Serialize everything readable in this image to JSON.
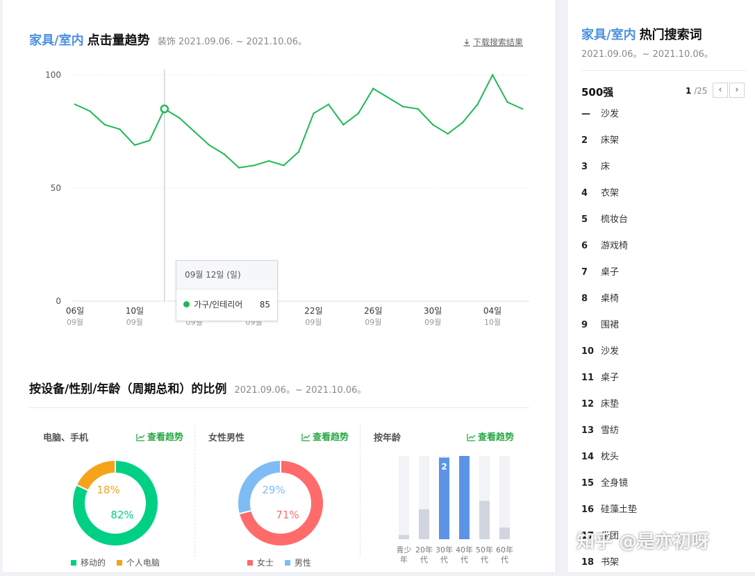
{
  "trend": {
    "title_highlight": "家具/室内",
    "title_main": "点击量趋势",
    "subtitle": "装饰 2021.09.06. ~ 2021.10.06。",
    "download_label": "下载搜索结果",
    "tooltip": {
      "date": "09월 12일 (일)",
      "series": "가구/인테리어",
      "value": "85"
    }
  },
  "chart_data": {
    "type": "line",
    "x": [
      "09-06",
      "09-07",
      "09-08",
      "09-09",
      "09-10",
      "09-11",
      "09-12",
      "09-13",
      "09-14",
      "09-15",
      "09-16",
      "09-17",
      "09-18",
      "09-19",
      "09-20",
      "09-21",
      "09-22",
      "09-23",
      "09-24",
      "09-25",
      "09-26",
      "09-27",
      "09-28",
      "09-29",
      "09-30",
      "10-01",
      "10-02",
      "10-03",
      "10-04",
      "10-05",
      "10-06"
    ],
    "values": [
      87,
      84,
      78,
      76,
      69,
      71,
      85,
      81,
      75,
      69,
      65,
      59,
      60,
      62,
      60,
      66,
      83,
      87,
      78,
      83,
      94,
      90,
      86,
      85,
      78,
      74,
      79,
      87,
      100,
      88,
      85
    ],
    "ylim": [
      0,
      100
    ],
    "y_ticks": [
      "0",
      "50",
      "100"
    ],
    "x_ticks": [
      {
        "day": "06일",
        "month": "09월"
      },
      {
        "day": "10일",
        "month": "09월"
      },
      {
        "day": "14일",
        "month": "09월"
      },
      {
        "day": "18일",
        "month": "09월"
      },
      {
        "day": "22일",
        "month": "09월"
      },
      {
        "day": "26일",
        "month": "09월"
      },
      {
        "day": "30일",
        "month": "09월"
      },
      {
        "day": "04일",
        "month": "10월"
      }
    ],
    "highlight_index": 6,
    "line_color": "#1db954",
    "grid": true
  },
  "ratio": {
    "title": "按设备/性别/年龄（周期总和）的比例",
    "date": "2021.09.06。~ 2021.10.06。",
    "trend_link": "查看趋势",
    "device": {
      "label": "电脑、手机",
      "slices": [
        {
          "name": "移动的",
          "value": 82,
          "label": "82%",
          "color": "#00d084"
        },
        {
          "name": "个人电脑",
          "value": 18,
          "label": "18%",
          "color": "#f5a31a"
        }
      ]
    },
    "gender": {
      "label": "女性男性",
      "slices": [
        {
          "name": "女士",
          "value": 71,
          "label": "71%",
          "color": "#ff6b6b"
        },
        {
          "name": "男性",
          "value": 29,
          "label": "29%",
          "color": "#7fbcf5"
        }
      ]
    },
    "age": {
      "label": "按年龄",
      "bars": [
        {
          "name": "青少年",
          "lines": [
            "青少",
            "年"
          ],
          "value": 0.05,
          "highlight": false,
          "value_label": ""
        },
        {
          "name": "20年代",
          "lines": [
            "20年",
            "代"
          ],
          "value": 0.36,
          "highlight": false,
          "value_label": ""
        },
        {
          "name": "30年代",
          "lines": [
            "30年",
            "代"
          ],
          "value": 0.98,
          "highlight": true,
          "value_label": "2"
        },
        {
          "name": "40年代",
          "lines": [
            "40年",
            "代"
          ],
          "value": 1.0,
          "highlight": true,
          "value_label": ""
        },
        {
          "name": "50年代",
          "lines": [
            "50年",
            "代"
          ],
          "value": 0.46,
          "highlight": false,
          "value_label": ""
        },
        {
          "name": "60年代",
          "lines": [
            "60年",
            "代"
          ],
          "value": 0.14,
          "highlight": false,
          "value_label": ""
        }
      ]
    }
  },
  "popular": {
    "title_highlight": "家具/室内",
    "title_main": "热门搜索词",
    "date": "2021.09.06。~ 2021.10.06。",
    "heading": "500强",
    "page_current": "1",
    "page_total": "/25",
    "prev_icon": "‹",
    "next_icon": "›",
    "items": [
      {
        "rank": "—",
        "keyword": "沙发"
      },
      {
        "rank": "2",
        "keyword": "床架"
      },
      {
        "rank": "3",
        "keyword": "床"
      },
      {
        "rank": "4",
        "keyword": "衣架"
      },
      {
        "rank": "5",
        "keyword": "梳妆台"
      },
      {
        "rank": "6",
        "keyword": "游戏椅"
      },
      {
        "rank": "7",
        "keyword": "桌子"
      },
      {
        "rank": "8",
        "keyword": "桌椅"
      },
      {
        "rank": "9",
        "keyword": "围裙"
      },
      {
        "rank": "10",
        "keyword": "沙发"
      },
      {
        "rank": "11",
        "keyword": "桌子"
      },
      {
        "rank": "12",
        "keyword": "床垫"
      },
      {
        "rank": "13",
        "keyword": "雪纺"
      },
      {
        "rank": "14",
        "keyword": "枕头"
      },
      {
        "rank": "15",
        "keyword": "全身镜"
      },
      {
        "rank": "16",
        "keyword": "硅藻土垫"
      },
      {
        "rank": "17",
        "keyword": "坐团"
      },
      {
        "rank": "18",
        "keyword": "书架"
      }
    ]
  },
  "watermark": "知乎 @是亦初呀"
}
